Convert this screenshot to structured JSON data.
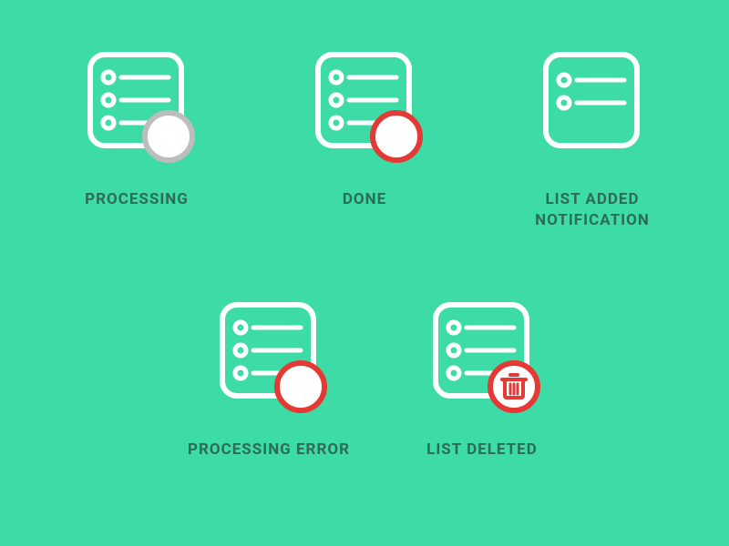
{
  "icons": [
    {
      "id": "processing",
      "label": "PROCESSING",
      "lines": 3,
      "badge": "gray-circle"
    },
    {
      "id": "done",
      "label": "DONE",
      "lines": 3,
      "badge": "red-circle"
    },
    {
      "id": "list-added",
      "label": "LIST ADDED NOTIFICATION",
      "lines": 2,
      "badge": null
    },
    {
      "id": "processing-error",
      "label": "PROCESSING ERROR",
      "lines": 3,
      "badge": "red-circle"
    },
    {
      "id": "list-deleted",
      "label": "LIST DELETED",
      "lines": 3,
      "badge": "trash"
    }
  ],
  "colors": {
    "bg": "#3DDBA5",
    "stroke": "#FFFFFF",
    "label": "#2C6B58",
    "badgeGray": "#BDBDBD",
    "badgeRed": "#E53935",
    "badgeFill": "#FFFFFF"
  }
}
